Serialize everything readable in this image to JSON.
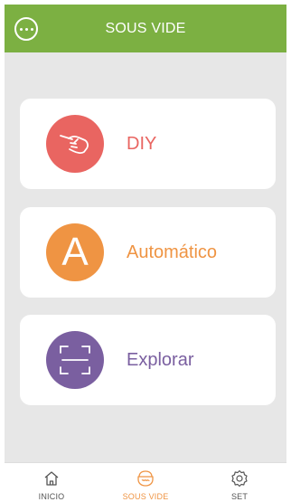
{
  "header": {
    "title": "SOUS VIDE",
    "menu_icon": "more-circle-icon"
  },
  "cards": [
    {
      "label": "DIY",
      "icon": "hand-icon",
      "color": "#e96561"
    },
    {
      "label": "Automático",
      "icon_letter": "A",
      "color": "#ef9443"
    },
    {
      "label": "Explorar",
      "icon": "scan-icon",
      "color": "#7a5fa0"
    }
  ],
  "bottom_nav": [
    {
      "label": "INICIO",
      "icon": "home-icon",
      "active": false
    },
    {
      "label": "SOUS VIDE",
      "icon": "pot-icon",
      "active": true
    },
    {
      "label": "SET",
      "icon": "gear-icon",
      "active": false
    }
  ],
  "colors": {
    "brand_green": "#7cb042",
    "active_tab": "#ef9443",
    "inactive_tab": "#555555"
  }
}
